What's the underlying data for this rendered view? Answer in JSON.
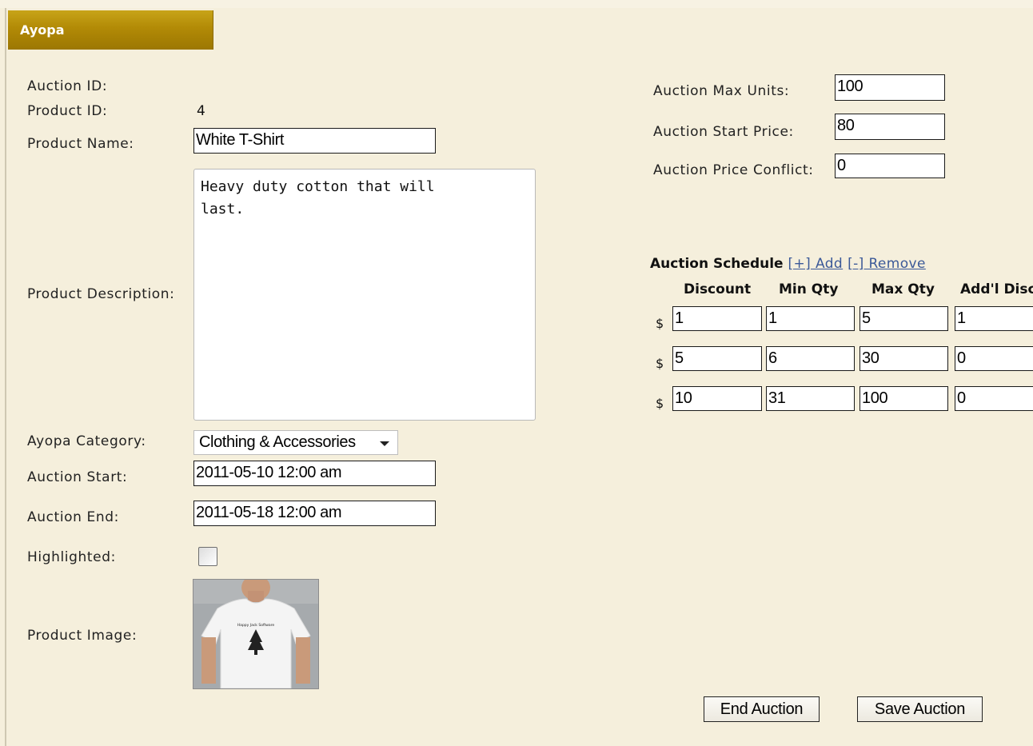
{
  "header": {
    "title": "Ayopa"
  },
  "left": {
    "auction_id": {
      "label": "Auction ID:",
      "value": ""
    },
    "product_id": {
      "label": "Product ID:",
      "value": "4"
    },
    "product_name": {
      "label": "Product Name:",
      "value": "White T-Shirt"
    },
    "product_description": {
      "label": "Product Description:",
      "value": "Heavy duty cotton that will\nlast."
    },
    "category": {
      "label": "Ayopa Category:",
      "value": "Clothing & Accessories"
    },
    "auction_start": {
      "label": "Auction Start:",
      "value": "2011-05-10 12:00 am"
    },
    "auction_end": {
      "label": "Auction End:",
      "value": "2011-05-18 12:00 am"
    },
    "highlighted": {
      "label": "Highlighted:",
      "checked": false
    },
    "product_image": {
      "label": "Product Image:",
      "shirt_text": "Happy Jack Software"
    }
  },
  "right": {
    "max_units": {
      "label": "Auction Max Units:",
      "value": "100"
    },
    "start_price": {
      "label": "Auction Start Price:",
      "value": "80"
    },
    "price_conflict": {
      "label": "Auction Price Conflict:",
      "value": "0"
    }
  },
  "schedule": {
    "title": "Auction Schedule",
    "add_link": "[+] Add",
    "remove_link": "[-] Remove",
    "columns": [
      "Discount",
      "Min Qty",
      "Max Qty",
      "Add'l Disc"
    ],
    "currency_symbol": "$",
    "rows": [
      [
        "1",
        "1",
        "5",
        "1"
      ],
      [
        "5",
        "6",
        "30",
        "0"
      ],
      [
        "10",
        "31",
        "100",
        "0"
      ]
    ]
  },
  "buttons": {
    "end_auction": "End Auction",
    "save_auction": "Save Auction"
  },
  "colors": {
    "background": "#f5efdc",
    "header_gold": "#b28a06",
    "link": "#3b5998"
  }
}
